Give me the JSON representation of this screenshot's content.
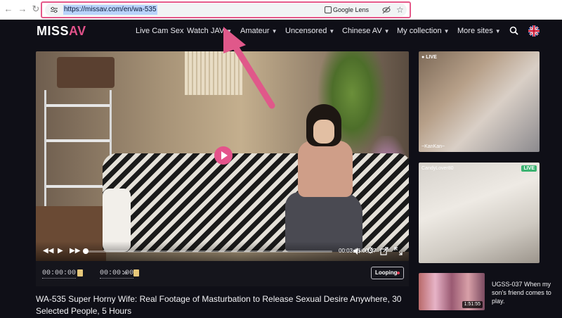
{
  "browser": {
    "url": "https://missav.com/en/wa-535",
    "lens_label": "Google Lens",
    "back_icon": "arrow-left-icon",
    "forward_icon": "arrow-right-icon",
    "reload_icon": "reload-icon",
    "highlight_color": "#e5598a"
  },
  "site": {
    "logo_part1": "MISS",
    "logo_part2": "AV",
    "nav": [
      "Live Cam Sex",
      "Watch JAV",
      "Amateur",
      "Uncensored",
      "Chinese AV",
      "My collection",
      "More sites"
    ],
    "accent": "#e2528a"
  },
  "player": {
    "current_time": "00:03",
    "separator": "/",
    "duration": "5:00:17",
    "progress_fraction": 0.0002
  },
  "subbar": {
    "start_time": "00:00:00",
    "end_time": "00:00:00",
    "forward_glyph": "»",
    "loop_label": "Looping"
  },
  "video": {
    "title": "WA-535 Super Horny Wife: Real Footage of Masturbation to Release Sexual Desire Anywhere, 30 Selected People, 5 Hours"
  },
  "sidebar": {
    "cam1": {
      "badge": "LIVE",
      "name": "~KanKan~"
    },
    "cam2": {
      "badge": "LIVE",
      "name": "CandyLover80"
    },
    "related": {
      "duration": "1:51:55",
      "title": "UGSS-037 When my son's friend comes to play."
    }
  }
}
